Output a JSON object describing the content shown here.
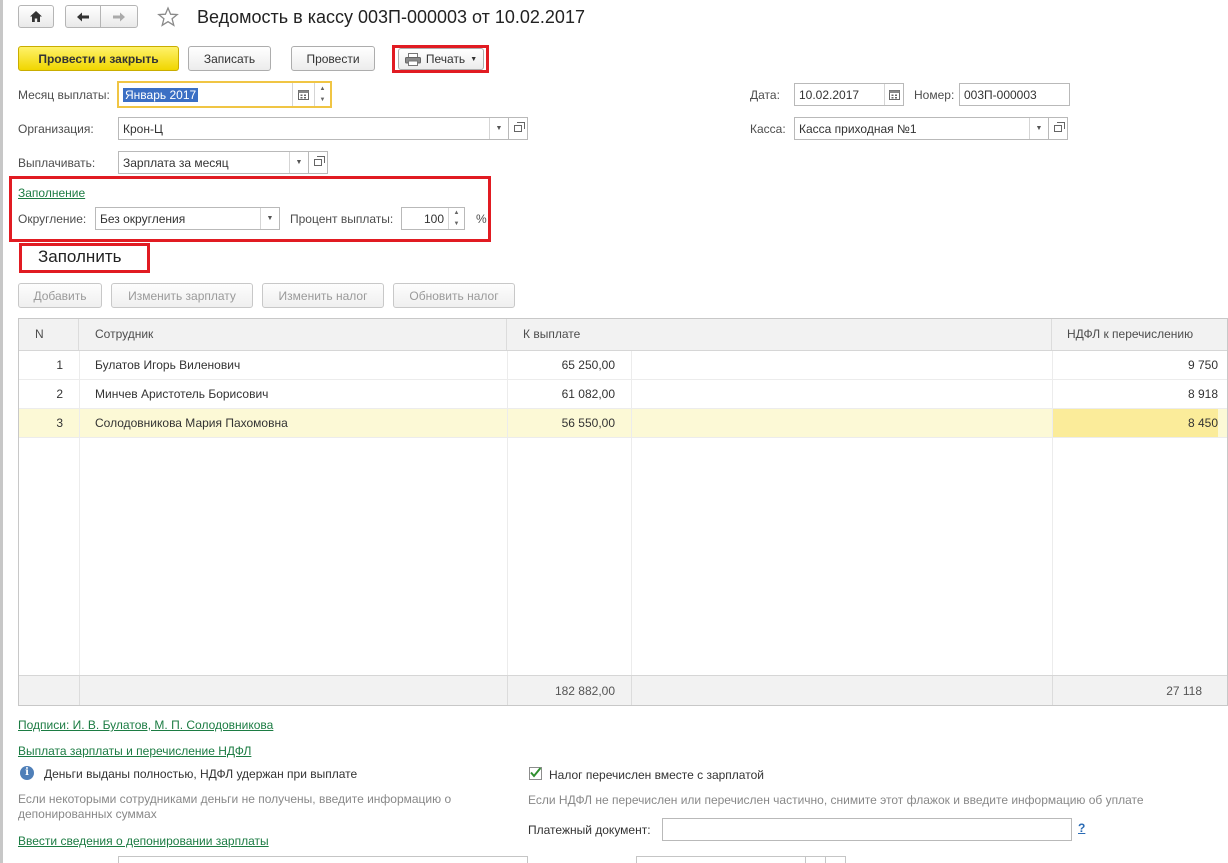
{
  "window": {
    "title": "Ведомость в кассу 003П-000003 от 10.02.2017"
  },
  "toolbar": {
    "post_and_close": "Провести и закрыть",
    "save": "Записать",
    "post": "Провести",
    "print": "Печать"
  },
  "form": {
    "month_label": "Месяц выплаты:",
    "month_value": "Январь 2017",
    "org_label": "Организация:",
    "org_value": "Крон-Ц",
    "pay_label": "Выплачивать:",
    "pay_value": "Зарплата за месяц",
    "date_label": "Дата:",
    "date_value": "10.02.2017",
    "number_label": "Номер:",
    "number_value": "003П-000003",
    "cash_label": "Касса:",
    "cash_value": "Касса приходная №1"
  },
  "filling": {
    "section_link": "Заполнение",
    "rounding_label": "Округление:",
    "rounding_value": "Без округления",
    "percent_label": "Процент выплаты:",
    "percent_value": "100",
    "percent_unit": "%",
    "fill_button": "Заполнить"
  },
  "table_toolbar": {
    "add": "Добавить",
    "change_salary": "Изменить зарплату",
    "change_tax": "Изменить налог",
    "update_tax": "Обновить налог"
  },
  "table": {
    "columns": [
      "N",
      "Сотрудник",
      "К выплате",
      "НДФЛ к перечислению"
    ],
    "rows": [
      {
        "n": "1",
        "employee": "Булатов Игорь Виленович",
        "amount": "65 250,00",
        "tax": "9 750"
      },
      {
        "n": "2",
        "employee": "Минчев Аристотель Борисович",
        "amount": "61 082,00",
        "tax": "8 918"
      },
      {
        "n": "3",
        "employee": "Солодовникова Мария Пахомовна",
        "amount": "56 550,00",
        "tax": "8 450"
      }
    ],
    "total_amount": "182 882,00",
    "total_tax": "27 118"
  },
  "footer": {
    "signatures_link": "Подписи: И. В. Булатов, М. П. Солодовникова",
    "payout_link": "Выплата зарплаты и перечисление НДФЛ",
    "info_text": "Деньги выданы полностью, НДФЛ удержан при выплате",
    "info_hint": "Если некоторыми сотрудниками деньги не получены, введите информацию о депонированных суммах",
    "deposit_link": "Ввести сведения о депонировании зарплаты",
    "tax_checkbox_label": "Налог перечислен вместе с зарплатой",
    "tax_checked": true,
    "tax_hint": "Если НДФЛ не перечислен или перечислен частично, снимите этот флажок и введите информацию об уплате",
    "payment_doc_label": "Платежный документ:",
    "payment_doc_value": "",
    "help_glyph": "?"
  },
  "colors": {
    "primary_button": "#f7e21c",
    "link": "#1c7c43",
    "highlight_box": "#e11b22",
    "selected_row": "#fcf9d6"
  }
}
